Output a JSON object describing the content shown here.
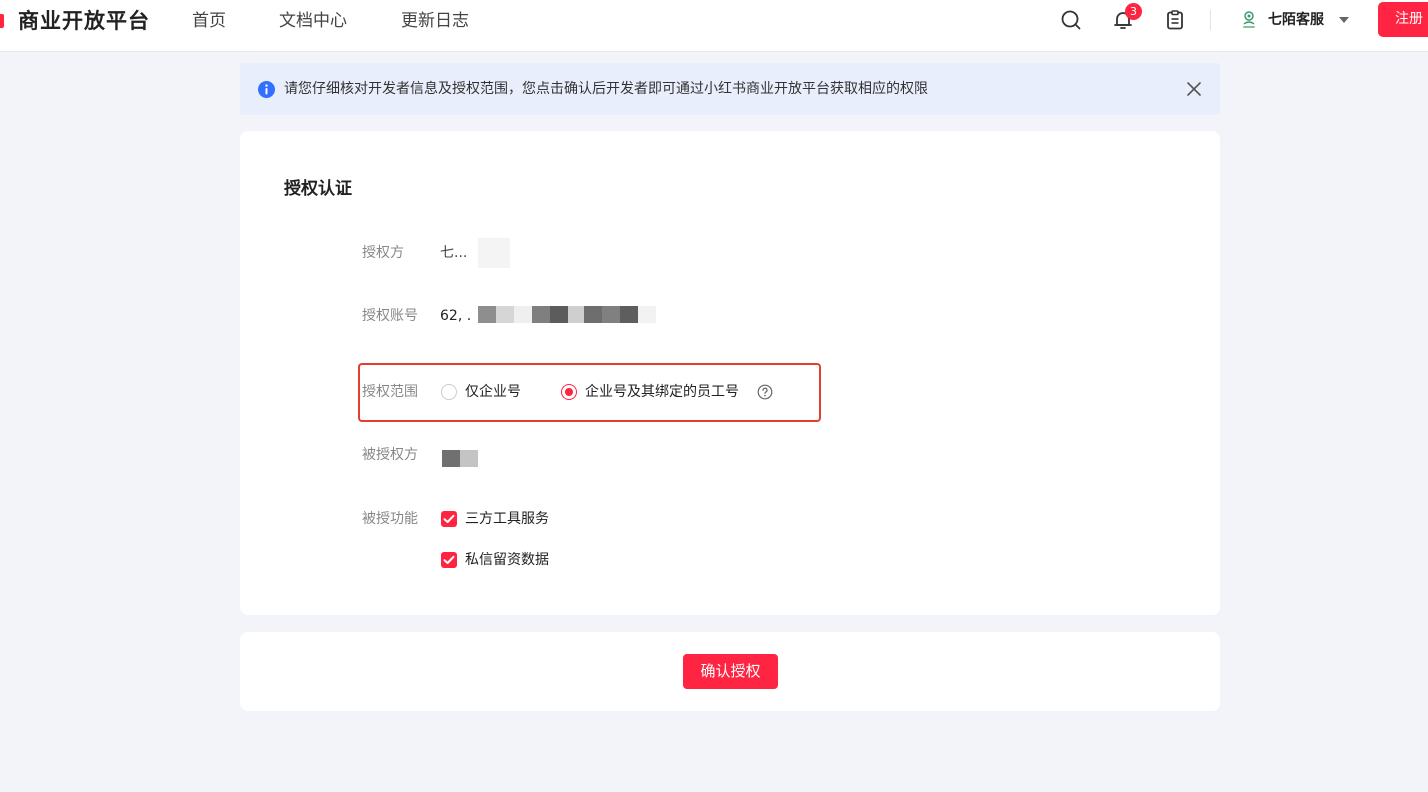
{
  "header": {
    "brand": "商业开放平台",
    "nav": [
      {
        "label": "首页"
      },
      {
        "label": "文档中心"
      },
      {
        "label": "更新日志"
      }
    ],
    "notification_count": "3",
    "account_name": "七陌客服",
    "register_label": "注册"
  },
  "notice": {
    "text": "请您仔细核对开发者信息及授权范围，您点击确认后开发者即可通过小红书商业开放平台获取相应的权限"
  },
  "form": {
    "title": "授权认证",
    "grantor": {
      "label": "授权方",
      "value": "七..."
    },
    "account": {
      "label": "授权账号",
      "value": "62, ."
    },
    "scope": {
      "label": "授权范围",
      "options": [
        {
          "label": "仅企业号",
          "selected": false
        },
        {
          "label": "企业号及其绑定的员工号",
          "selected": true
        }
      ]
    },
    "grantee": {
      "label": "被授权方"
    },
    "functions": {
      "label": "被授功能",
      "items": [
        {
          "label": "三方工具服务",
          "checked": true
        },
        {
          "label": "私信留资数据",
          "checked": true
        }
      ]
    }
  },
  "footer": {
    "confirm_label": "确认授权"
  },
  "colors": {
    "accent": "#ff2442",
    "highlight_border": "#e43d30",
    "notice_bg": "#e9eefc",
    "info_blue": "#3370ff"
  }
}
